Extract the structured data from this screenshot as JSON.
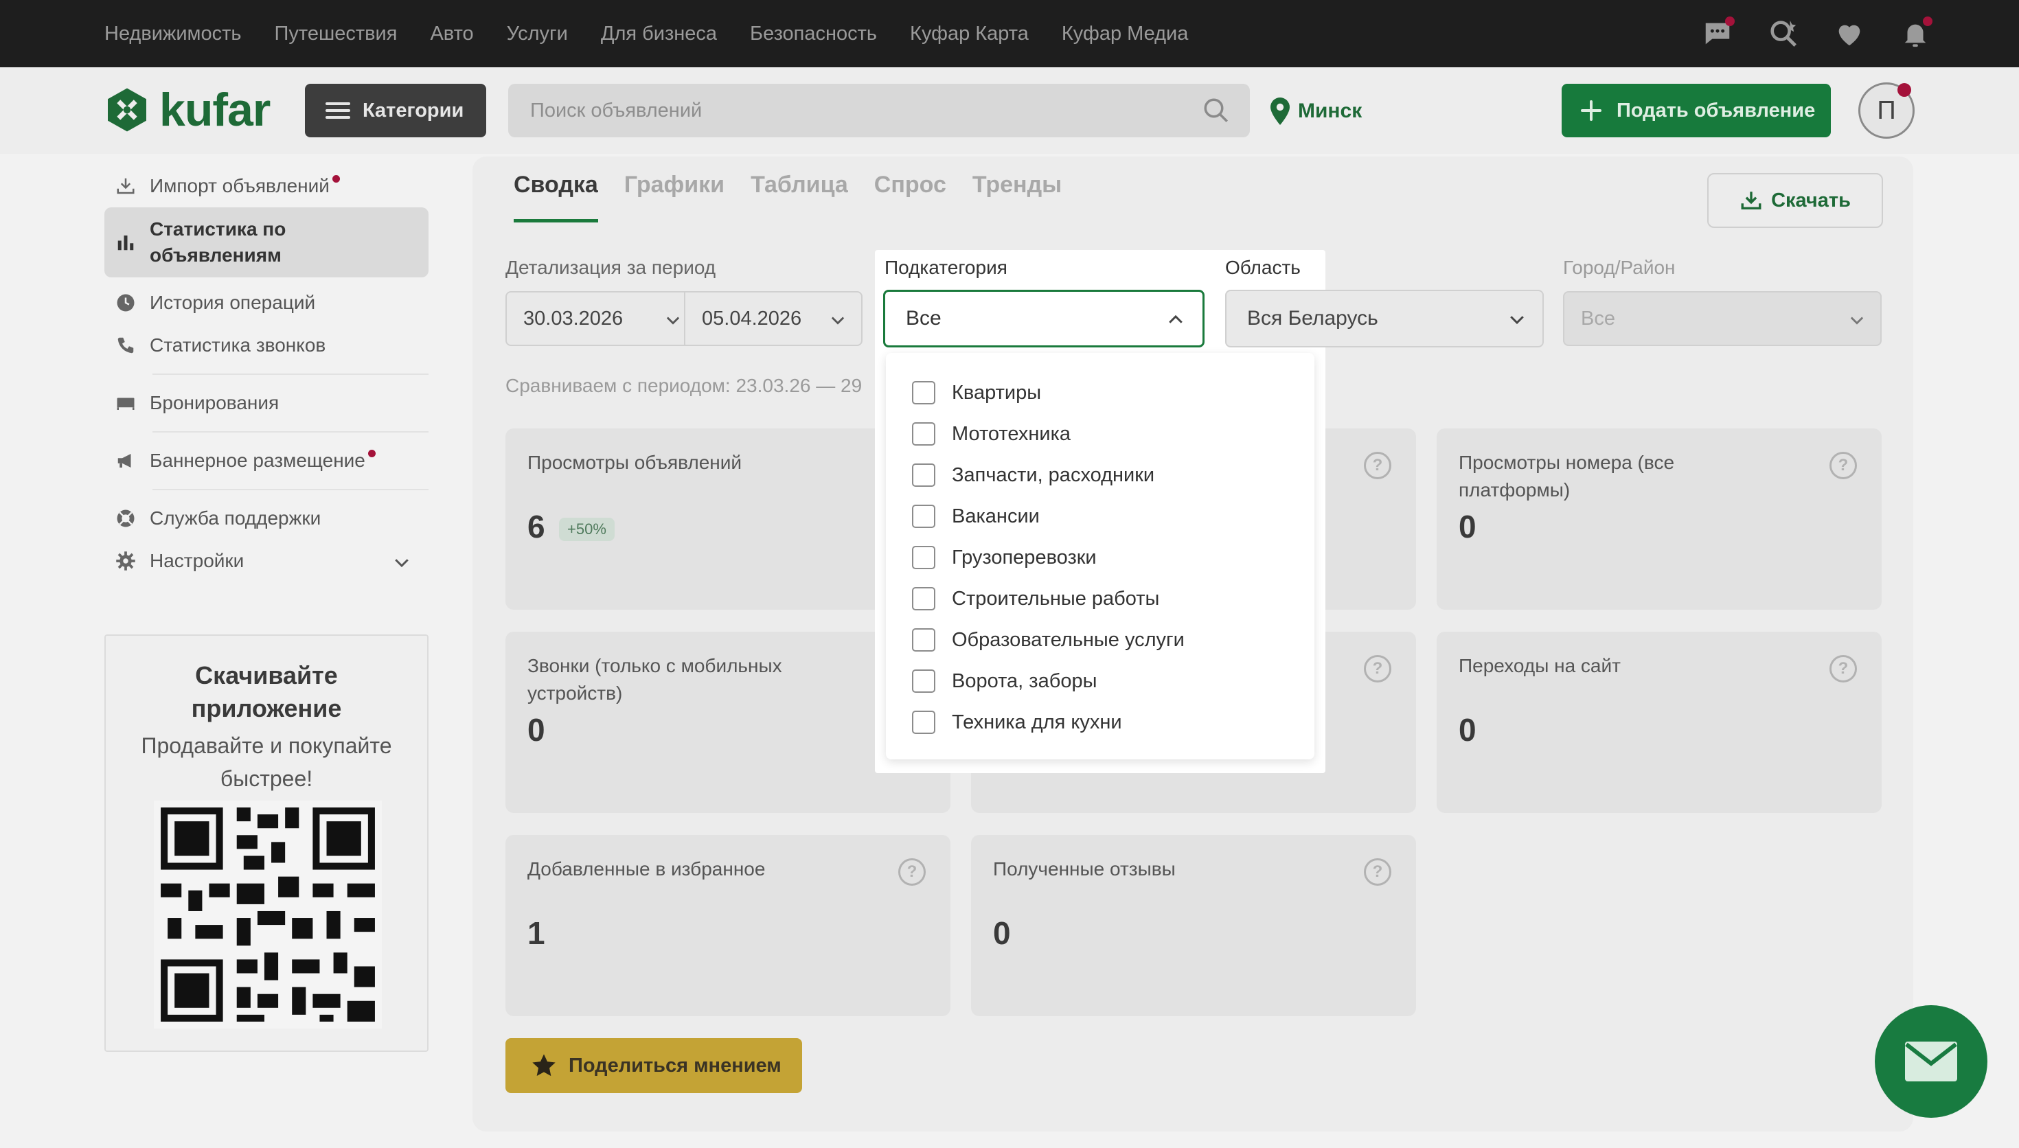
{
  "top_nav": {
    "links": [
      "Недвижимость",
      "Путешествия",
      "Авто",
      "Услуги",
      "Для бизнеса",
      "Безопасность",
      "Куфар Карта",
      "Куфар Медиа"
    ],
    "icons": [
      "messages-icon",
      "saved-search-icon",
      "heart-icon",
      "bell-icon"
    ]
  },
  "header": {
    "logo_text": "kufar",
    "categories_label": "Категории",
    "search_placeholder": "Поиск объявлений",
    "city": "Минск",
    "post_ad_label": "Подать объявление",
    "avatar_letter": "П"
  },
  "sidebar": {
    "items": [
      {
        "label": "Импорт объявлений",
        "icon": "import-icon",
        "dot": true
      },
      {
        "label": "Статистика по объявлениям",
        "icon": "bar-chart-icon",
        "active": true
      },
      {
        "label": "История операций",
        "icon": "clock-icon"
      },
      {
        "label": "Статистика звонков",
        "icon": "phone-icon"
      },
      {
        "label": "Бронирования",
        "icon": "bed-icon"
      },
      {
        "label": "Баннерное размещение",
        "icon": "megaphone-icon",
        "dot": true
      },
      {
        "label": "Служба поддержки",
        "icon": "lifebuoy-icon"
      },
      {
        "label": "Настройки",
        "icon": "gear-icon"
      }
    ],
    "app_card": {
      "title": "Скачивайте приложение",
      "subtitle": "Продавайте и покупайте быстрее!"
    }
  },
  "main": {
    "tabs": [
      "Сводка",
      "Графики",
      "Таблица",
      "Спрос",
      "Тренды"
    ],
    "active_tab": "Сводка",
    "download_label": "Скачать",
    "period_label": "Детализация за период",
    "date_from": "30.03.2026",
    "date_to": "05.04.2026",
    "subcategory_label": "Подкатегория",
    "subcategory_value": "Все",
    "region_label": "Область",
    "region_value": "Вся Беларусь",
    "city_label": "Город/Район",
    "city_value": "Все",
    "compare_text": "Сравниваем с периодом: 23.03.26 — 29",
    "cards": [
      {
        "title": "Просмотры объявлений",
        "value": "6",
        "badge": "+50%"
      },
      {
        "title": "",
        "value": ""
      },
      {
        "title": "Просмотры номера (все платформы)",
        "value": "0"
      },
      {
        "title": "Звонки (только с мобильных устройств)",
        "value": "0"
      },
      {
        "title": "",
        "value": ""
      },
      {
        "title": "Переходы на сайт",
        "value": "0"
      },
      {
        "title": "Добавленные в избранное",
        "value": "1"
      },
      {
        "title": "Полученные отзывы",
        "value": "0"
      }
    ],
    "share_label": "Поделиться мнением"
  },
  "dropdown": {
    "options": [
      "Квартиры",
      "Мототехника",
      "Запчасти, расходники",
      "Вакансии",
      "Грузоперевозки",
      "Строительные работы",
      "Образовательные услуги",
      "Ворота, заборы",
      "Техника для кухни"
    ]
  },
  "colors": {
    "brand_green": "#1a7a3c",
    "accent_red": "#a4123a",
    "share_yellow": "#c4a335"
  }
}
